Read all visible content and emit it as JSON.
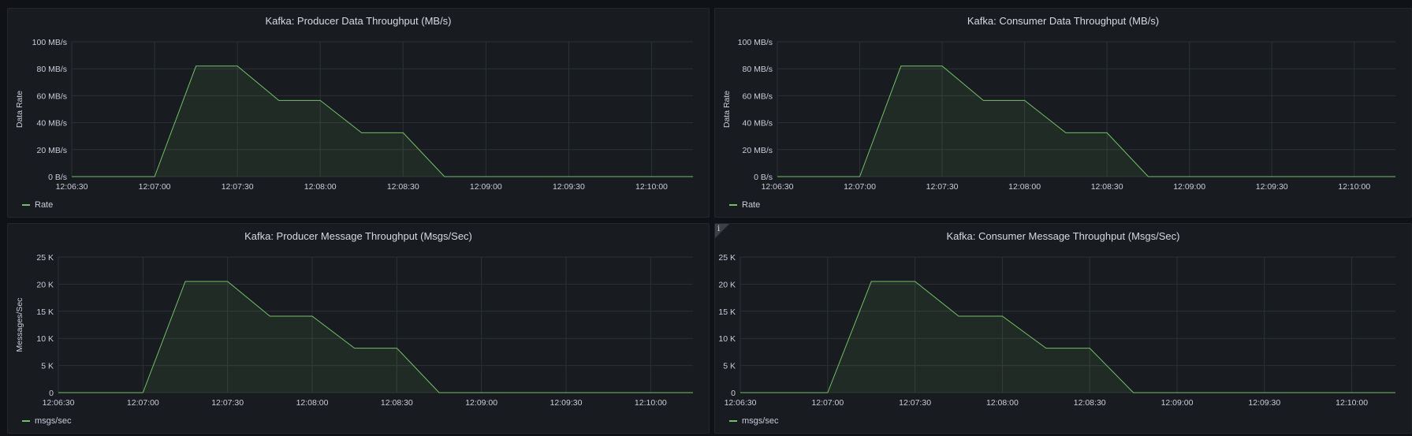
{
  "colors": {
    "series": "#73bf69",
    "grid": "#2c3235",
    "panel_bg": "#181b1f"
  },
  "panels": [
    {
      "title": "Kafka: Producer Data Throughput (MB/s)",
      "ylabel": "Data Rate",
      "legend": "Rate",
      "has_info": false
    },
    {
      "title": "Kafka: Consumer Data Throughput (MB/s)",
      "ylabel": "Data Rate",
      "legend": "Rate",
      "has_info": false
    },
    {
      "title": "Kafka: Producer Message Throughput (Msgs/Sec)",
      "ylabel": "Messages/Sec",
      "legend": "msgs/sec",
      "has_info": false
    },
    {
      "title": "Kafka: Consumer Message Throughput (Msgs/Sec)",
      "ylabel": "",
      "legend": "msgs/sec",
      "has_info": true,
      "info_icon": "info-icon"
    }
  ],
  "chart_data": [
    {
      "type": "area",
      "title": "Kafka: Producer Data Throughput (MB/s)",
      "ylabel": "Data Rate",
      "xlabel": "",
      "x_ticks": [
        "12:06:30",
        "12:07:00",
        "12:07:30",
        "12:08:00",
        "12:08:30",
        "12:09:00",
        "12:09:30",
        "12:10:00"
      ],
      "y_ticks": [
        "0 B/s",
        "20 MB/s",
        "40 MB/s",
        "60 MB/s",
        "80 MB/s",
        "100 MB/s"
      ],
      "ylim": [
        0,
        100
      ],
      "xlim": [
        "12:06:30",
        "12:10:15"
      ],
      "grid": true,
      "legend_position": "bottom-left",
      "series": [
        {
          "name": "Rate",
          "x": [
            "12:06:30",
            "12:07:00",
            "12:07:15",
            "12:07:30",
            "12:07:45",
            "12:08:00",
            "12:08:15",
            "12:08:30",
            "12:08:45",
            "12:09:00",
            "12:10:15"
          ],
          "values": [
            0,
            0,
            82,
            82,
            56.5,
            56.5,
            32.5,
            32.5,
            0,
            0,
            0
          ]
        }
      ]
    },
    {
      "type": "area",
      "title": "Kafka: Consumer Data Throughput (MB/s)",
      "ylabel": "Data Rate",
      "xlabel": "",
      "x_ticks": [
        "12:06:30",
        "12:07:00",
        "12:07:30",
        "12:08:00",
        "12:08:30",
        "12:09:00",
        "12:09:30",
        "12:10:00"
      ],
      "y_ticks": [
        "0 B/s",
        "20 MB/s",
        "40 MB/s",
        "60 MB/s",
        "80 MB/s",
        "100 MB/s"
      ],
      "ylim": [
        0,
        100
      ],
      "xlim": [
        "12:06:30",
        "12:10:15"
      ],
      "grid": true,
      "legend_position": "bottom-left",
      "series": [
        {
          "name": "Rate",
          "x": [
            "12:06:30",
            "12:07:00",
            "12:07:15",
            "12:07:30",
            "12:07:45",
            "12:08:00",
            "12:08:15",
            "12:08:30",
            "12:08:45",
            "12:09:00",
            "12:10:15"
          ],
          "values": [
            0,
            0,
            82,
            82,
            56.5,
            56.5,
            32.5,
            32.5,
            0,
            0,
            0
          ]
        }
      ]
    },
    {
      "type": "area",
      "title": "Kafka: Producer Message Throughput (Msgs/Sec)",
      "ylabel": "Messages/Sec",
      "xlabel": "",
      "x_ticks": [
        "12:06:30",
        "12:07:00",
        "12:07:30",
        "12:08:00",
        "12:08:30",
        "12:09:00",
        "12:09:30",
        "12:10:00"
      ],
      "y_ticks": [
        "0",
        "5 K",
        "10 K",
        "15 K",
        "20 K",
        "25 K"
      ],
      "ylim": [
        0,
        25000
      ],
      "xlim": [
        "12:06:30",
        "12:10:15"
      ],
      "grid": true,
      "legend_position": "bottom-left",
      "series": [
        {
          "name": "msgs/sec",
          "x": [
            "12:06:30",
            "12:07:00",
            "12:07:15",
            "12:07:30",
            "12:07:45",
            "12:08:00",
            "12:08:15",
            "12:08:30",
            "12:08:45",
            "12:09:00",
            "12:10:15"
          ],
          "values": [
            0,
            0,
            20500,
            20500,
            14100,
            14100,
            8200,
            8200,
            0,
            0,
            0
          ]
        }
      ]
    },
    {
      "type": "area",
      "title": "Kafka: Consumer Message Throughput (Msgs/Sec)",
      "ylabel": "",
      "xlabel": "",
      "x_ticks": [
        "12:06:30",
        "12:07:00",
        "12:07:30",
        "12:08:00",
        "12:08:30",
        "12:09:00",
        "12:09:30",
        "12:10:00"
      ],
      "y_ticks": [
        "0",
        "5 K",
        "10 K",
        "15 K",
        "20 K",
        "25 K"
      ],
      "ylim": [
        0,
        25000
      ],
      "xlim": [
        "12:06:30",
        "12:10:15"
      ],
      "grid": true,
      "legend_position": "bottom-left",
      "series": [
        {
          "name": "msgs/sec",
          "x": [
            "12:06:30",
            "12:07:00",
            "12:07:15",
            "12:07:30",
            "12:07:45",
            "12:08:00",
            "12:08:15",
            "12:08:30",
            "12:08:45",
            "12:09:00",
            "12:10:15"
          ],
          "values": [
            0,
            0,
            20500,
            20500,
            14100,
            14100,
            8200,
            8200,
            0,
            0,
            0
          ]
        }
      ]
    }
  ]
}
